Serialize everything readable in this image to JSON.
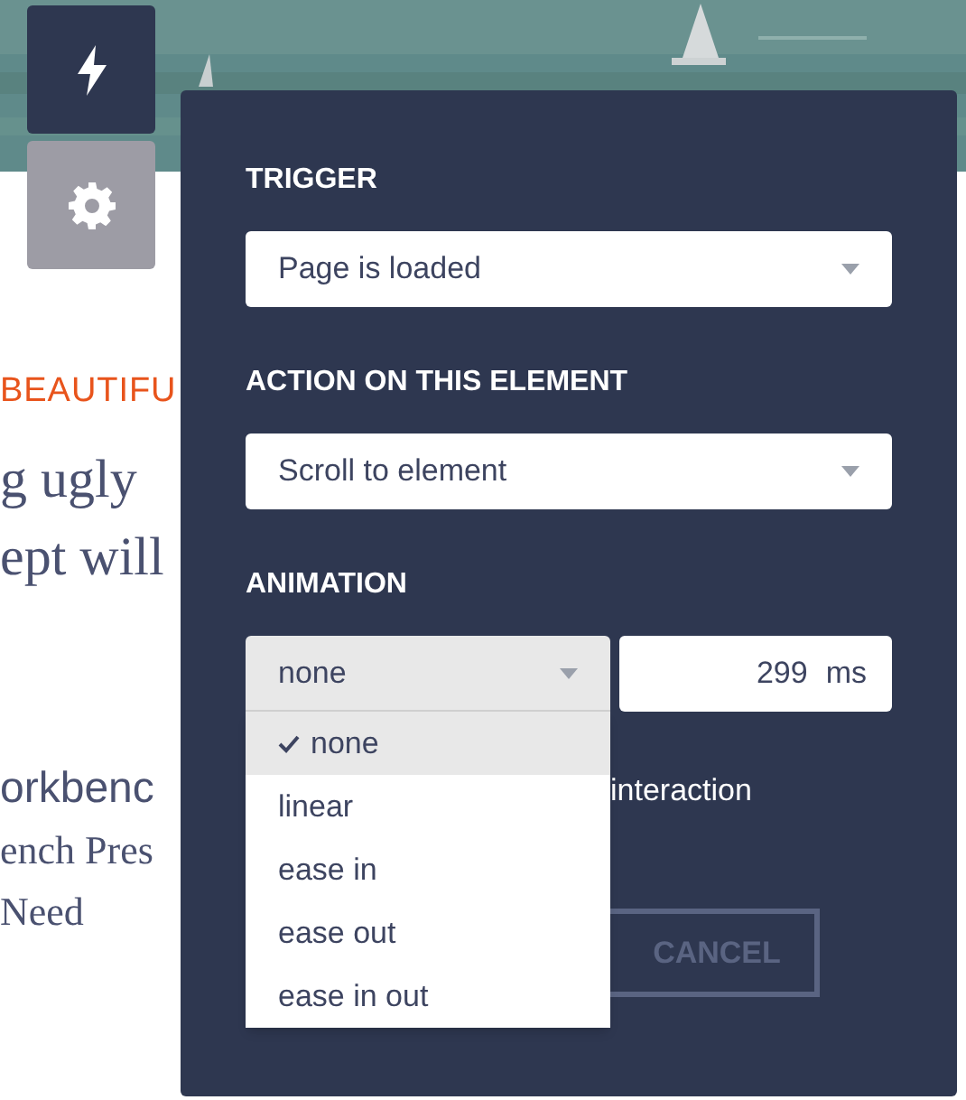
{
  "page": {
    "eyebrow": "BEAUTIFU",
    "lines": [
      {
        "kind": "serif",
        "text": "g ugly"
      },
      {
        "kind": "serif",
        "text": "ept will"
      },
      {
        "kind": "heading",
        "text": "orkbenc"
      },
      {
        "kind": "serif-small",
        "text": "ench Pres"
      },
      {
        "kind": "serif-small",
        "text": "Need"
      }
    ]
  },
  "side_buttons": [
    {
      "kind": "bolt",
      "selected": true
    },
    {
      "kind": "gear",
      "selected": false
    }
  ],
  "panel": {
    "sections": [
      {
        "label": "TRIGGER",
        "value": "Page is loaded"
      },
      {
        "label": "ACTION ON THIS ELEMENT",
        "value": "Scroll to element"
      }
    ],
    "animation": {
      "label": "ANIMATION",
      "value": "none",
      "duration": "299",
      "unit": "ms",
      "options": [
        {
          "label": "none",
          "selected": true
        },
        {
          "label": "linear",
          "selected": false
        },
        {
          "label": "ease in",
          "selected": false
        },
        {
          "label": "ease out",
          "selected": false
        },
        {
          "label": "ease in out",
          "selected": false
        }
      ]
    },
    "note": "interaction",
    "cancel": "CANCEL"
  }
}
